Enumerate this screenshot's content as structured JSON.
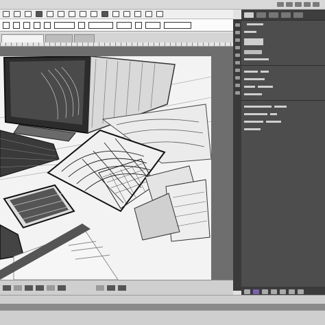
{
  "window": {
    "doc_tab_labels": [
      "",
      "",
      ""
    ]
  },
  "toolbar": {
    "icons": [
      "move-icon",
      "marquee-icon",
      "lasso-icon",
      "crop-icon",
      "eyedropper-icon",
      "brush-icon",
      "stamp-icon",
      "eraser-icon",
      "gradient-icon",
      "pen-icon",
      "text-icon",
      "shape-icon",
      "hand-icon",
      "zoom-icon"
    ]
  },
  "options_bar": {
    "fields": [
      "",
      "",
      "",
      "",
      ""
    ]
  },
  "panel": {
    "rows": [
      "",
      "",
      "",
      "",
      "",
      "",
      "",
      "",
      "",
      "",
      "",
      ""
    ]
  },
  "colors": {
    "panel_bg": "#4d4d4d",
    "canvas_bg": "#f6f6f6",
    "accent": "#7b5fb0"
  }
}
